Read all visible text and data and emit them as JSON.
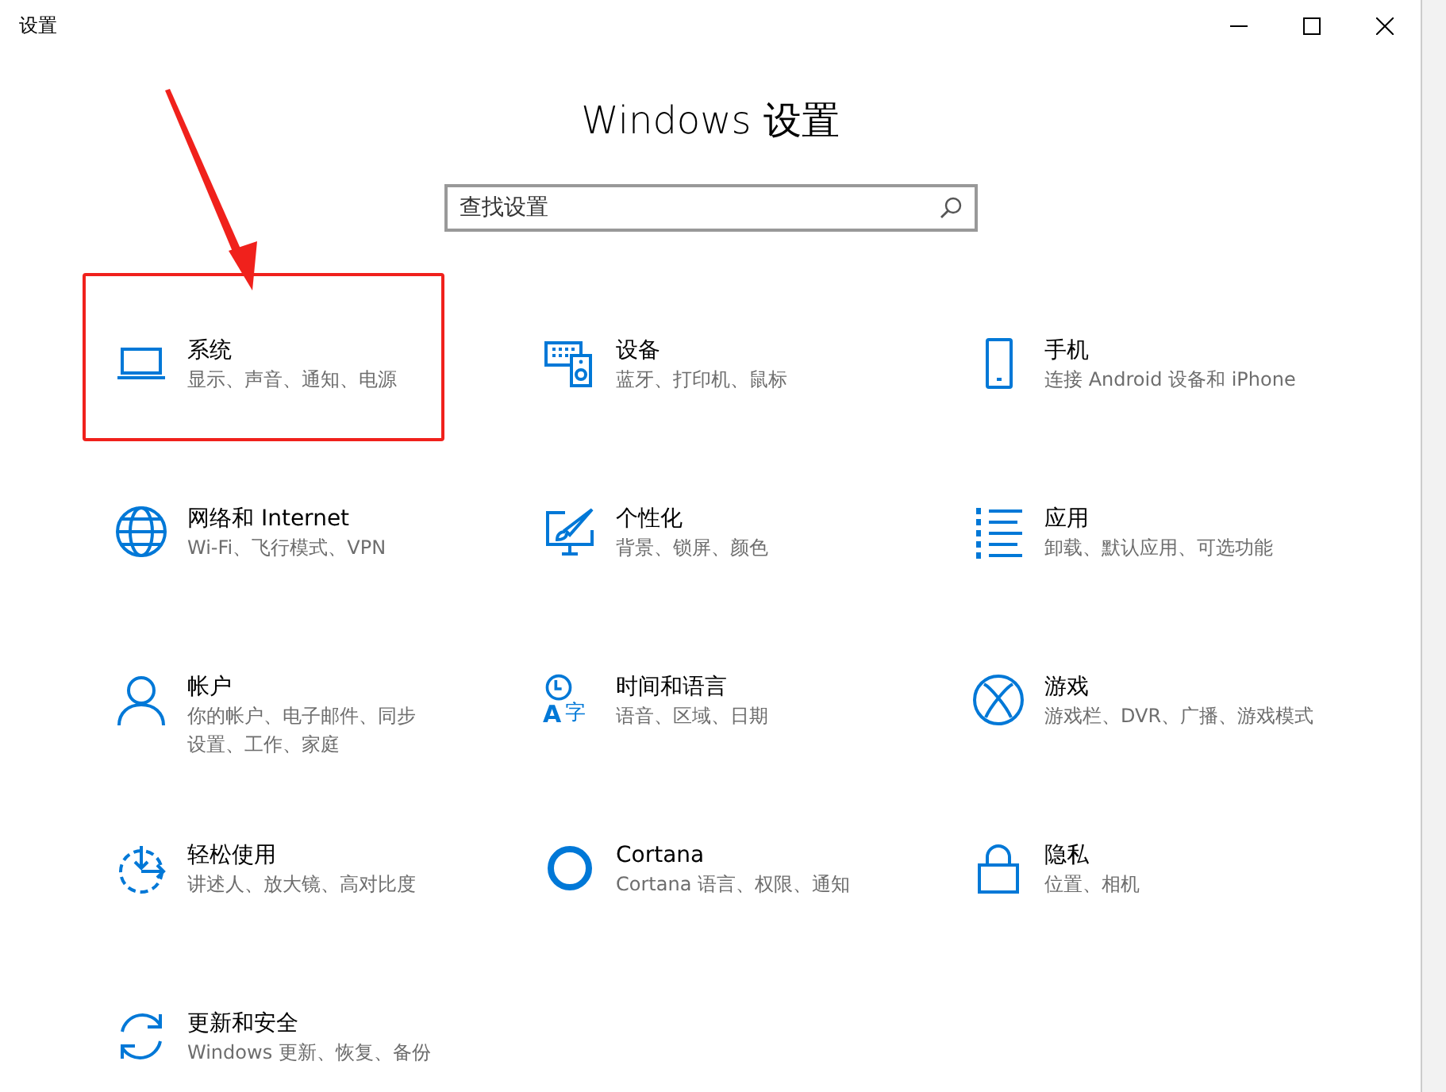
{
  "window": {
    "title": "设置",
    "heading": "Windows 设置"
  },
  "search": {
    "placeholder": "查找设置"
  },
  "annotation": {
    "arrow_to_item": true
  },
  "items": [
    {
      "title": "系统",
      "description": "显示、声音、通知、电源",
      "highlighted": true
    },
    {
      "title": "设备",
      "description": "蓝牙、打印机、鼠标",
      "highlighted": false
    },
    {
      "title": "手机",
      "description": "连接 Android 设备和 iPhone",
      "highlighted": false
    },
    {
      "title": "网络和 Internet",
      "description": "Wi-Fi、飞行模式、VPN",
      "highlighted": false
    },
    {
      "title": "个性化",
      "description": "背景、锁屏、颜色",
      "highlighted": false
    },
    {
      "title": "应用",
      "description": "卸载、默认应用、可选功能",
      "highlighted": false
    },
    {
      "title": "帐户",
      "description": "你的帐户、电子邮件、同步设置、工作、家庭",
      "highlighted": false
    },
    {
      "title": "时间和语言",
      "description": "语音、区域、日期",
      "highlighted": false,
      "icon_glyphs": [
        "A",
        "字"
      ]
    },
    {
      "title": "游戏",
      "description": "游戏栏、DVR、广播、游戏模式",
      "highlighted": false
    },
    {
      "title": "轻松使用",
      "description": "讲述人、放大镜、高对比度",
      "highlighted": false
    },
    {
      "title": "Cortana",
      "description": "Cortana 语言、权限、通知",
      "highlighted": false
    },
    {
      "title": "隐私",
      "description": "位置、相机",
      "highlighted": false
    },
    {
      "title": "更新和安全",
      "description": "Windows 更新、恢复、备份",
      "highlighted": false
    }
  ]
}
